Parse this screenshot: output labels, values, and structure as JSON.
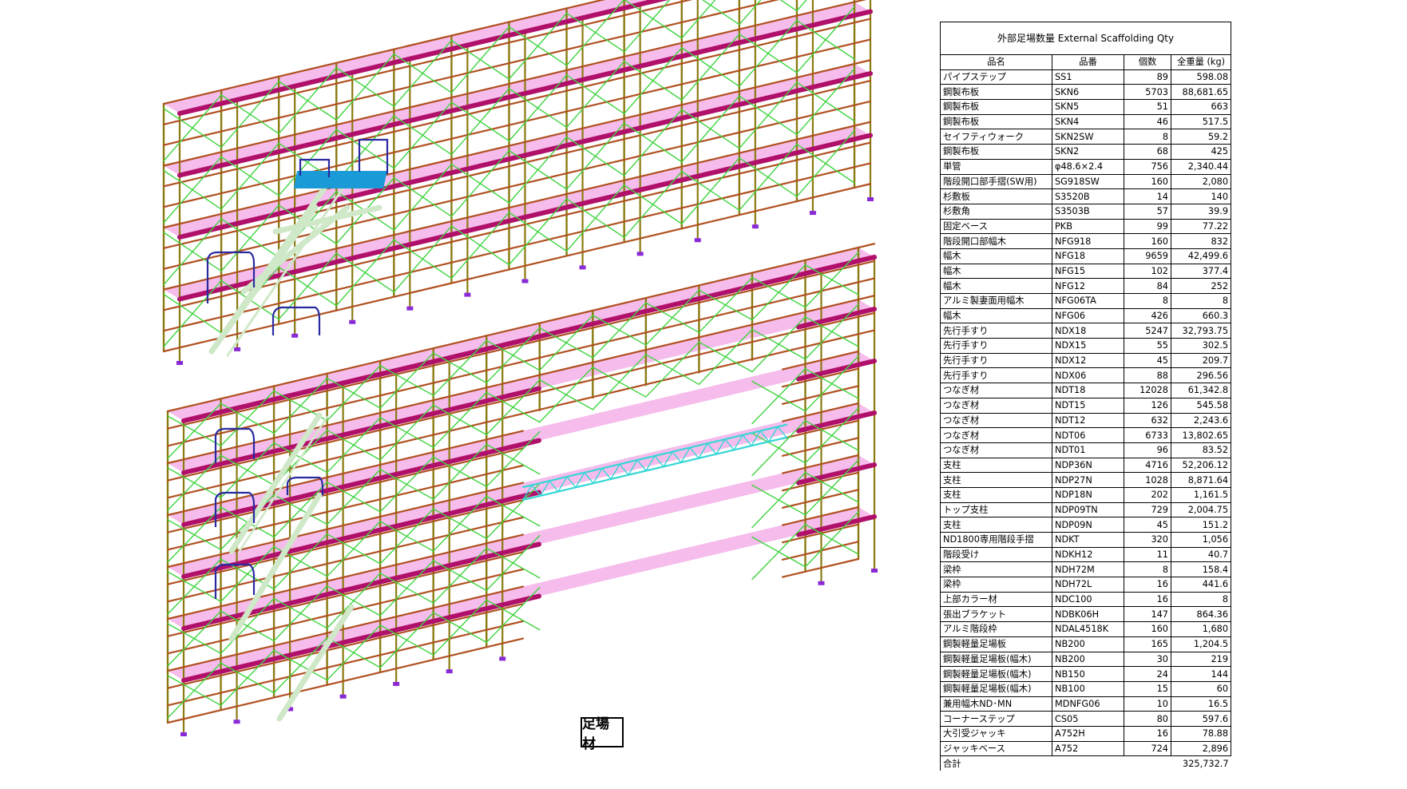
{
  "drawing": {
    "label": "足場材",
    "colors": {
      "standard": "#8a7a10",
      "ledger": "#b05020",
      "brace": "#3fd43f",
      "deck": "#b0106a",
      "deck_fill": "#f2a6e6",
      "truss": "#36d6d6",
      "handrail": "#2a2aa0",
      "stair": "#cfe8c8",
      "stair_top": "#1a9ad6",
      "base": "#8a2ad6"
    }
  },
  "table": {
    "title": "外部足場数量 External Scaffolding Qty",
    "headers": [
      "品名",
      "品番",
      "個数",
      "全重量 (kg)"
    ],
    "rows": [
      {
        "name": "パイプステップ",
        "code": "SS1",
        "count": "89",
        "weight": "598.08"
      },
      {
        "name": "鋼製布板",
        "code": "SKN6",
        "count": "5703",
        "weight": "88,681.65"
      },
      {
        "name": "鋼製布板",
        "code": "SKN5",
        "count": "51",
        "weight": "663"
      },
      {
        "name": "鋼製布板",
        "code": "SKN4",
        "count": "46",
        "weight": "517.5"
      },
      {
        "name": "セイフティウォーク",
        "code": "SKN2SW",
        "count": "8",
        "weight": "59.2"
      },
      {
        "name": "鋼製布板",
        "code": "SKN2",
        "count": "68",
        "weight": "425"
      },
      {
        "name": "単管",
        "code": "φ48.6×2.4",
        "count": "756",
        "weight": "2,340.44"
      },
      {
        "name": "階段開口部手摺(SW用)",
        "code": "SG918SW",
        "count": "160",
        "weight": "2,080"
      },
      {
        "name": "杉敷板",
        "code": "S3520B",
        "count": "14",
        "weight": "140"
      },
      {
        "name": "杉敷角",
        "code": "S3503B",
        "count": "57",
        "weight": "39.9"
      },
      {
        "name": "固定ベース",
        "code": "PKB",
        "count": "99",
        "weight": "77.22"
      },
      {
        "name": "階段開口部幅木",
        "code": "NFG918",
        "count": "160",
        "weight": "832"
      },
      {
        "name": "幅木",
        "code": "NFG18",
        "count": "9659",
        "weight": "42,499.6"
      },
      {
        "name": "幅木",
        "code": "NFG15",
        "count": "102",
        "weight": "377.4"
      },
      {
        "name": "幅木",
        "code": "NFG12",
        "count": "84",
        "weight": "252"
      },
      {
        "name": "アルミ製妻面用幅木",
        "code": "NFG06TA",
        "count": "8",
        "weight": "8"
      },
      {
        "name": "幅木",
        "code": "NFG06",
        "count": "426",
        "weight": "660.3"
      },
      {
        "name": "先行手すり",
        "code": "NDX18",
        "count": "5247",
        "weight": "32,793.75"
      },
      {
        "name": "先行手すり",
        "code": "NDX15",
        "count": "55",
        "weight": "302.5"
      },
      {
        "name": "先行手すり",
        "code": "NDX12",
        "count": "45",
        "weight": "209.7"
      },
      {
        "name": "先行手すり",
        "code": "NDX06",
        "count": "88",
        "weight": "296.56"
      },
      {
        "name": "つなぎ材",
        "code": "NDT18",
        "count": "12028",
        "weight": "61,342.8"
      },
      {
        "name": "つなぎ材",
        "code": "NDT15",
        "count": "126",
        "weight": "545.58"
      },
      {
        "name": "つなぎ材",
        "code": "NDT12",
        "count": "632",
        "weight": "2,243.6"
      },
      {
        "name": "つなぎ材",
        "code": "NDT06",
        "count": "6733",
        "weight": "13,802.65"
      },
      {
        "name": "つなぎ材",
        "code": "NDT01",
        "count": "96",
        "weight": "83.52"
      },
      {
        "name": "支柱",
        "code": "NDP36N",
        "count": "4716",
        "weight": "52,206.12"
      },
      {
        "name": "支柱",
        "code": "NDP27N",
        "count": "1028",
        "weight": "8,871.64"
      },
      {
        "name": "支柱",
        "code": "NDP18N",
        "count": "202",
        "weight": "1,161.5"
      },
      {
        "name": "トップ支柱",
        "code": "NDP09TN",
        "count": "729",
        "weight": "2,004.75"
      },
      {
        "name": "支柱",
        "code": "NDP09N",
        "count": "45",
        "weight": "151.2"
      },
      {
        "name": "ND1800専用階段手摺",
        "code": "NDKT",
        "count": "320",
        "weight": "1,056"
      },
      {
        "name": "階段受け",
        "code": "NDKH12",
        "count": "11",
        "weight": "40.7"
      },
      {
        "name": "梁枠",
        "code": "NDH72M",
        "count": "8",
        "weight": "158.4"
      },
      {
        "name": "梁枠",
        "code": "NDH72L",
        "count": "16",
        "weight": "441.6"
      },
      {
        "name": "上部カラー材",
        "code": "NDC100",
        "count": "16",
        "weight": "8"
      },
      {
        "name": "張出ブラケット",
        "code": "NDBK06H",
        "count": "147",
        "weight": "864.36"
      },
      {
        "name": "アルミ階段枠",
        "code": "NDAL4518K",
        "count": "160",
        "weight": "1,680"
      },
      {
        "name": "鋼製軽量足場板",
        "code": "NB200",
        "count": "165",
        "weight": "1,204.5"
      },
      {
        "name": "鋼製軽量足場板(幅木)",
        "code": "NB200",
        "count": "30",
        "weight": "219"
      },
      {
        "name": "鋼製軽量足場板(幅木)",
        "code": "NB150",
        "count": "24",
        "weight": "144"
      },
      {
        "name": "鋼製軽量足場板(幅木)",
        "code": "NB100",
        "count": "15",
        "weight": "60"
      },
      {
        "name": "兼用幅木ND･MN",
        "code": "MDNFG06",
        "count": "10",
        "weight": "16.5"
      },
      {
        "name": "コーナーステップ",
        "code": "CS05",
        "count": "80",
        "weight": "597.6"
      },
      {
        "name": "大引受ジャッキ",
        "code": "A752H",
        "count": "16",
        "weight": "78.88"
      },
      {
        "name": "ジャッキベース",
        "code": "A752",
        "count": "724",
        "weight": "2,896"
      }
    ],
    "total_label": "合計",
    "total_weight": "325,732.7"
  }
}
